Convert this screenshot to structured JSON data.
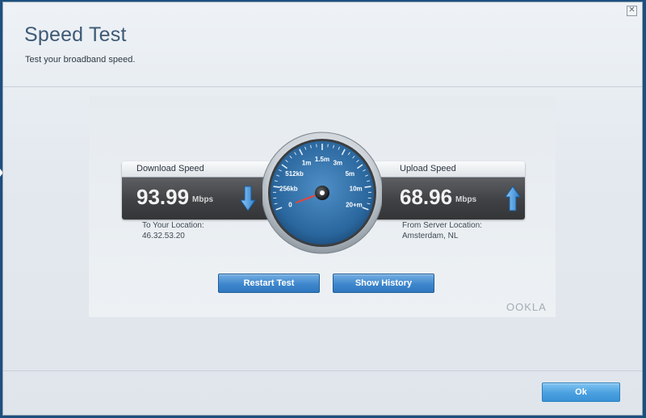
{
  "dialog": {
    "title": "Speed Test",
    "subtitle": "Test your broadband speed.",
    "close_icon": "close-icon"
  },
  "download": {
    "label": "Download Speed",
    "value": "93.99",
    "unit": "Mbps",
    "icon": "arrow-down-icon",
    "location_label": "To Your Location:",
    "location_value": "46.32.53.20"
  },
  "upload": {
    "label": "Upload Speed",
    "value": "68.96",
    "unit": "Mbps",
    "icon": "arrow-up-icon",
    "location_label": "From Server Location:",
    "location_value": "Amsterdam, NL"
  },
  "gauge": {
    "ticks": [
      "0",
      "256kb",
      "512kb",
      "1m",
      "1.5m",
      "3m",
      "5m",
      "10m",
      "20+m"
    ]
  },
  "buttons": {
    "restart": "Restart Test",
    "history": "Show History",
    "ok": "Ok"
  },
  "brand": "OOKLA",
  "colors": {
    "accent": "#3f87cd",
    "gauge_face": "#2d6aa0",
    "needle": "#e8433a"
  }
}
